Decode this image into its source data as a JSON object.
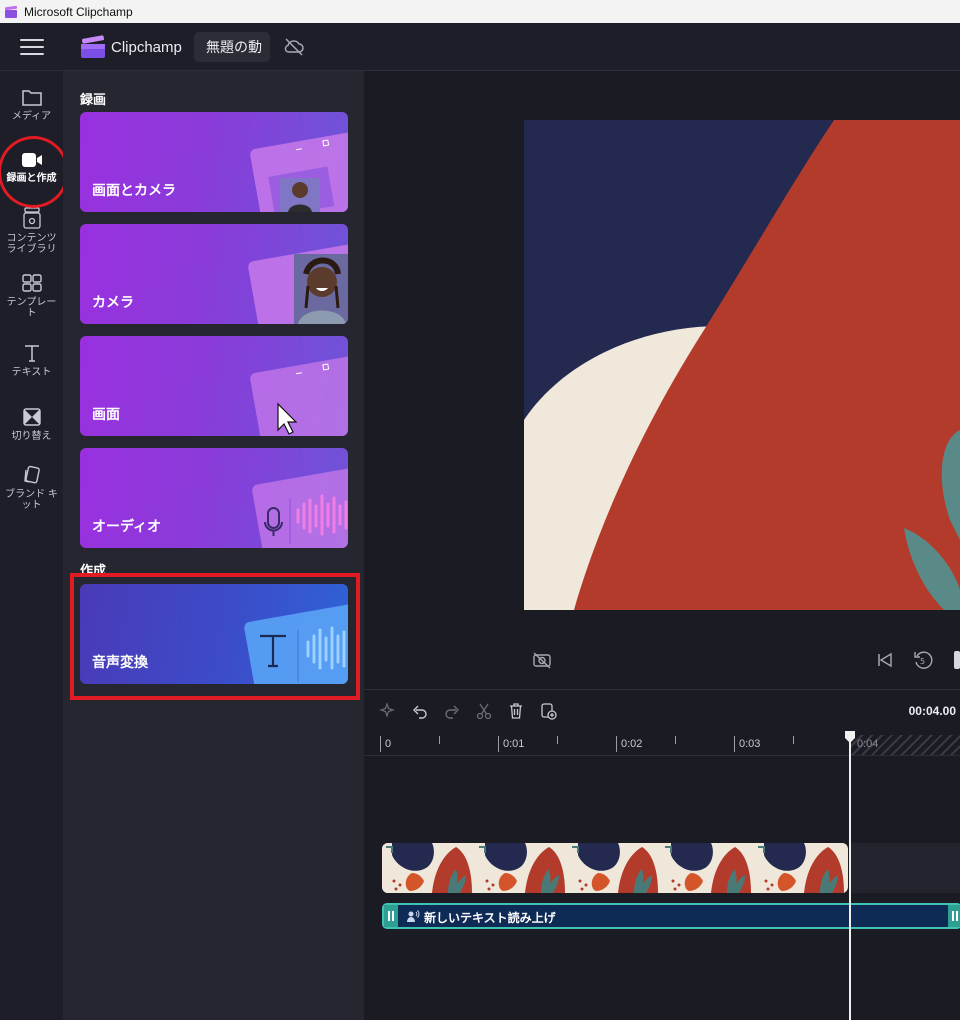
{
  "window": {
    "title": "Microsoft Clipchamp"
  },
  "header": {
    "brand": "Clipchamp",
    "project_title": "無題の動"
  },
  "rail": {
    "items": [
      {
        "id": "media",
        "label": "メディア"
      },
      {
        "id": "record",
        "label": "録画と作成",
        "active": true
      },
      {
        "id": "content",
        "label": "コンテンツ\nライブラリ"
      },
      {
        "id": "templates",
        "label": "テンプレー\nト"
      },
      {
        "id": "text",
        "label": "テキスト"
      },
      {
        "id": "transitions",
        "label": "切り替え"
      },
      {
        "id": "brand",
        "label": "ブランド キ\nット"
      }
    ]
  },
  "panel": {
    "record_section": "録画",
    "create_section": "作成",
    "cards": [
      {
        "id": "screen-camera",
        "label": "画面とカメラ"
      },
      {
        "id": "camera",
        "label": "カメラ"
      },
      {
        "id": "screen",
        "label": "画面"
      },
      {
        "id": "audio",
        "label": "オーディオ"
      },
      {
        "id": "tts",
        "label": "音声変換"
      }
    ]
  },
  "timeline": {
    "current_time": "00:04.00",
    "ticks": [
      "0",
      "0:01",
      "0:02",
      "0:03",
      "0:04"
    ],
    "audio_clip_label": "新しいテキスト読み上げ"
  },
  "colors": {
    "accent_teal": "#3fc3b2",
    "annotation_red": "#e01b24",
    "canvas_red": "#b33b2b",
    "canvas_navy": "#23294f",
    "canvas_cream": "#f0e9db"
  }
}
